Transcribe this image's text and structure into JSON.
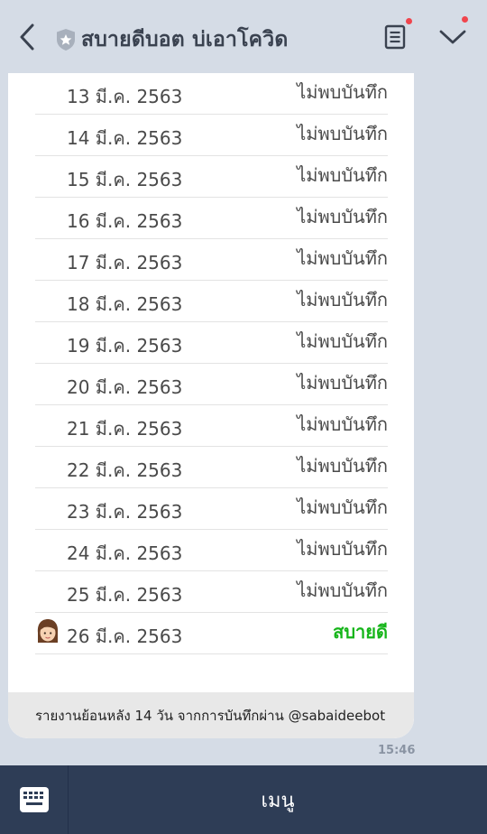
{
  "header": {
    "title": "สบายดีบอต บ่เอาโควิด",
    "icons": [
      "back-arrow-icon",
      "shield-star-icon",
      "notes-icon",
      "chevron-down-icon"
    ],
    "dot_color": "#f0454d"
  },
  "report": {
    "rows": [
      {
        "date": "13 มี.ค. 2563",
        "status": "ไม่พบบันทึก"
      },
      {
        "date": "14 มี.ค. 2563",
        "status": "ไม่พบบันทึก"
      },
      {
        "date": "15 มี.ค. 2563",
        "status": "ไม่พบบันทึก"
      },
      {
        "date": "16 มี.ค. 2563",
        "status": "ไม่พบบันทึก"
      },
      {
        "date": "17 มี.ค. 2563",
        "status": "ไม่พบบันทึก"
      },
      {
        "date": "18 มี.ค. 2563",
        "status": "ไม่พบบันทึก"
      },
      {
        "date": "19 มี.ค. 2563",
        "status": "ไม่พบบันทึก"
      },
      {
        "date": "20 มี.ค. 2563",
        "status": "ไม่พบบันทึก"
      },
      {
        "date": "21 มี.ค. 2563",
        "status": "ไม่พบบันทึก"
      },
      {
        "date": "22 มี.ค. 2563",
        "status": "ไม่พบบันทึก"
      },
      {
        "date": "23 มี.ค. 2563",
        "status": "ไม่พบบันทึก"
      },
      {
        "date": "24 มี.ค. 2563",
        "status": "ไม่พบบันทึก"
      },
      {
        "date": "25 มี.ค. 2563",
        "status": "ไม่พบบันทึก"
      },
      {
        "date": "26 มี.ค. 2563",
        "status": "สบายดี",
        "avatar": "girl-avatar-icon"
      }
    ],
    "footer": "รายงานย้อนหลัง 14 วัน จากการบันทึกผ่าน @sabaideebot",
    "ok_color": "#16b51a"
  },
  "message_time": "15:46",
  "bottom_bar": {
    "keyboard_icon": "keyboard-icon",
    "menu_label": "เมนู",
    "bg_color": "#2e3d56"
  }
}
